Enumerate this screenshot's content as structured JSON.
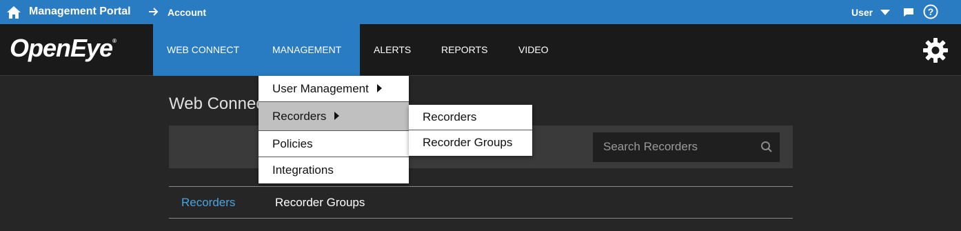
{
  "topbar": {
    "portal_title": "Management Portal",
    "breadcrumb": "Account",
    "user_label": "User",
    "icons": [
      "home-icon",
      "arrow-right-icon",
      "chevron-down-icon",
      "chat-icon",
      "help-icon"
    ]
  },
  "nav": {
    "logo": "OpenEye",
    "logo_mark": "®",
    "items": [
      "WEB CONNECT",
      "MANAGEMENT",
      "ALERTS",
      "REPORTS",
      "VIDEO"
    ],
    "active": "MANAGEMENT",
    "accent_color": "#2a7cc2"
  },
  "page": {
    "title": "Web Connect",
    "search_placeholder": "Search Recorders",
    "tabs": [
      "Recorders",
      "Recorder Groups"
    ],
    "active_tab": "Recorders",
    "active_tab_color": "#4aa3e0"
  },
  "menu": {
    "items": [
      "User Management",
      "Recorders",
      "Policies",
      "Integrations"
    ],
    "hovered": "Recorders"
  },
  "submenu": {
    "items": [
      "Recorders",
      "Recorder Groups"
    ]
  }
}
